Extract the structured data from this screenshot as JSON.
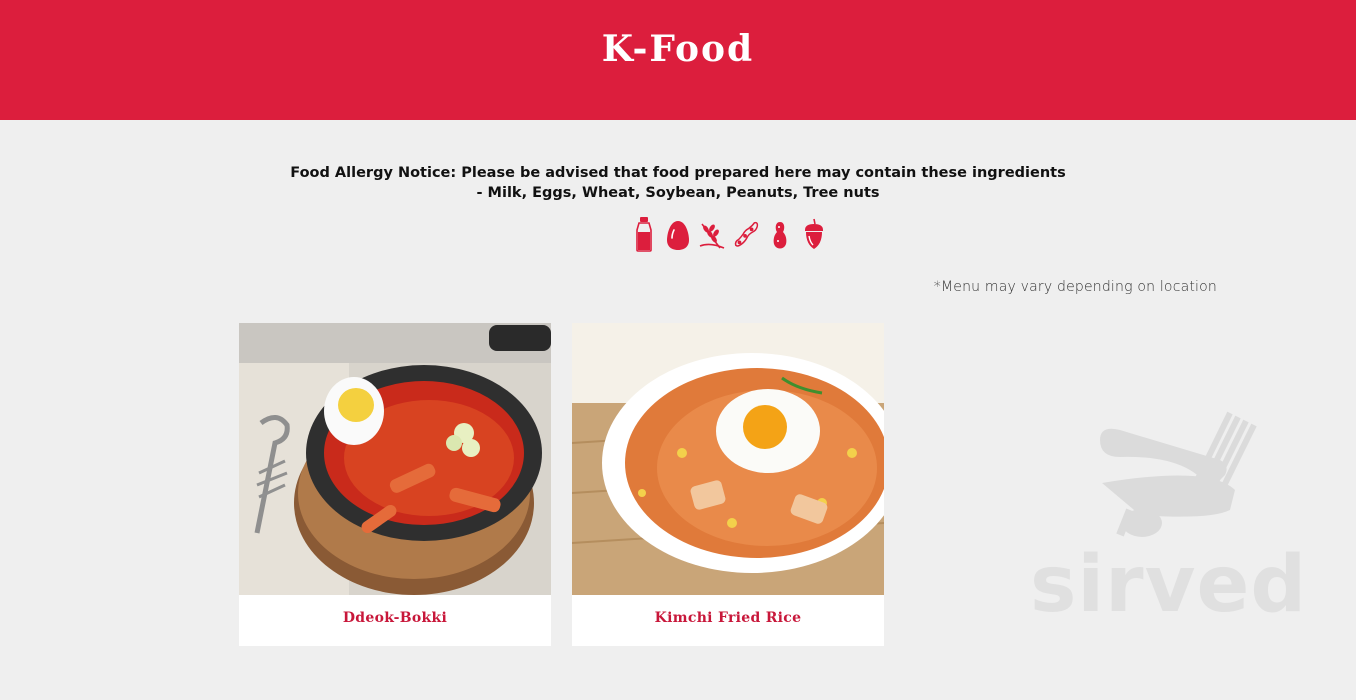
{
  "header": {
    "title": "K-Food"
  },
  "notice": {
    "line1": "Food Allergy Notice: Please be advised that food prepared here may contain these ingredients",
    "line2": "- Milk, Eggs, Wheat, Soybean, Peanuts, Tree nuts"
  },
  "allergen_icons": [
    "milk-icon",
    "egg-icon",
    "wheat-icon",
    "soybean-icon",
    "peanut-icon",
    "tree-nut-icon"
  ],
  "menu_note": "*Menu may vary depending on location",
  "menu_items": [
    {
      "name": "Ddeok-Bokki",
      "image": "ddeok-bokki-photo"
    },
    {
      "name": "Kimchi Fried Rice",
      "image": "kimchi-fried-rice-photo"
    }
  ],
  "watermark": {
    "text": "sirved"
  },
  "colors": {
    "brand_red": "#dc1e3d",
    "title_red": "#c8173a",
    "background": "#efefef"
  }
}
